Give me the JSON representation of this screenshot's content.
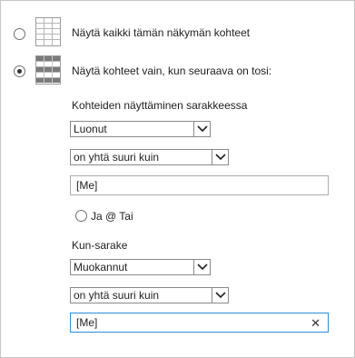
{
  "options": {
    "show_all_label": "Näytä kaikki tämän näkymän kohteet",
    "show_filtered_label": "Näytä kohteet vain, kun seuraava on tosi:",
    "selected": "show_filtered"
  },
  "filter1": {
    "section_label": "Kohteiden näyttäminen sarakkeessa",
    "column_value": "Luonut",
    "operator_value": "on yhtä suuri kuin",
    "input_value": "[Me]"
  },
  "logic": {
    "label": "Ja @ Tai"
  },
  "filter2": {
    "section_label": "Kun-sarake",
    "column_value": "Muokannut",
    "operator_value": "on yhtä suuri kuin",
    "input_value": "[Me]",
    "clear_glyph": "✕"
  }
}
